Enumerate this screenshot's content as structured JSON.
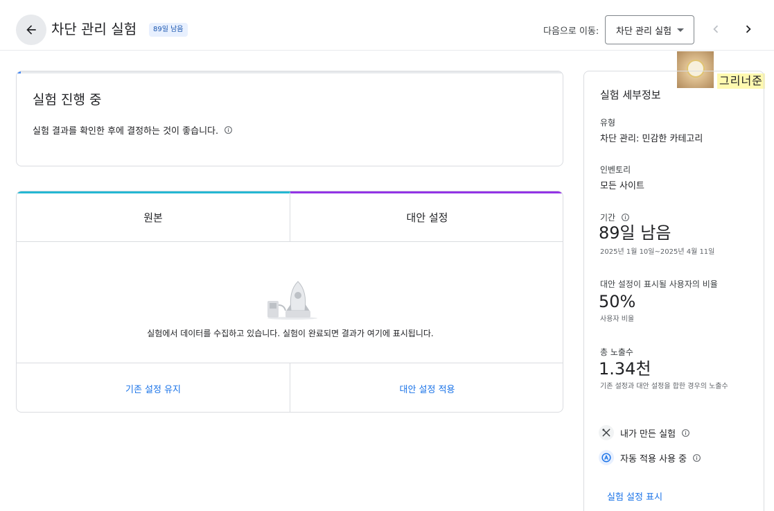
{
  "header": {
    "title": "차단 관리 실험",
    "badge": "89일 남음",
    "goto_label": "다음으로 이동:",
    "goto_value": "차단 관리 실험"
  },
  "user": {
    "name": "그리너준"
  },
  "status": {
    "title": "실험 진행 중",
    "description": "실험 결과를 확인한 후에 결정하는 것이 좋습니다."
  },
  "comparison": {
    "original_label": "원본",
    "alternative_label": "대안 설정",
    "message": "실험에서 데이터를 수집하고 있습니다. 실험이 완료되면 결과가 여기에 표시됩니다.",
    "keep_action": "기존 설정 유지",
    "apply_action": "대안 설정 적용"
  },
  "details": {
    "title": "실험 세부정보",
    "type_label": "유형",
    "type_value": "차단 관리: 민감한 카테고리",
    "inventory_label": "인벤토리",
    "inventory_value": "모든 사이트",
    "duration_label": "기간",
    "duration_value": "89일 남음",
    "duration_range": "2025년 1월 10일~2025년 4월 11일",
    "ratio_label": "대안 설정이 표시될 사용자의 비율",
    "ratio_value": "50%",
    "ratio_caption": "사용자 비율",
    "impressions_label": "총 노출수",
    "impressions_value": "1.34천",
    "impressions_caption": "기존 설정과 대안 설정을 합한 경우의 노출수",
    "created_by_me": "내가 만든 실험",
    "auto_apply": "자동 적용 사용 중",
    "show_settings": "실험 설정 표시"
  },
  "colors": {
    "original_accent": "#25b7d3",
    "alternative_accent": "#9334e6",
    "link": "#1a73e8"
  }
}
